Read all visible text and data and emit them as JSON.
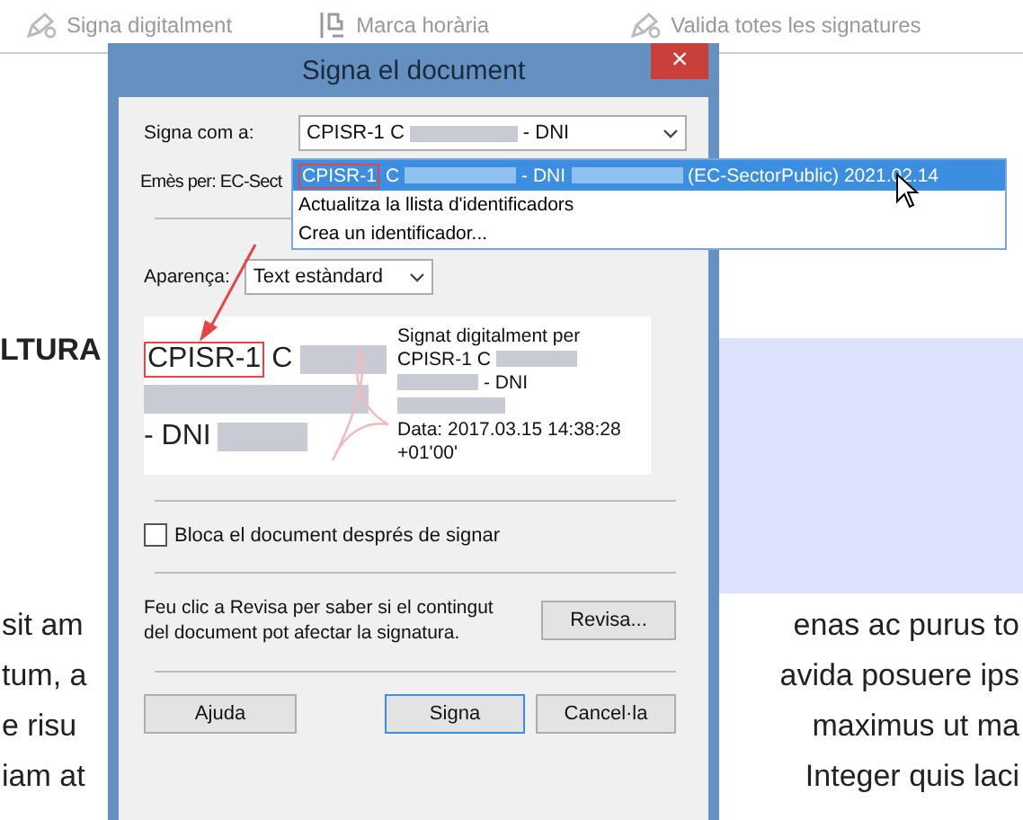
{
  "toolbar": {
    "items": [
      {
        "label": "Signa digitalment"
      },
      {
        "label": "Marca horària"
      },
      {
        "label": "Valida totes les signatures"
      }
    ]
  },
  "page": {
    "heading": "LTURA",
    "lines": [
      {
        "left": "sit am",
        "right": "enas ac purus to"
      },
      {
        "left": "tum, a",
        "right": "avida posuere ips"
      },
      {
        "left": "e risu",
        "right": "maximus ut ma"
      },
      {
        "left": "iam at",
        "right": "Integer quis laci"
      }
    ]
  },
  "dialog": {
    "title": "Signa el document",
    "close": "×",
    "sign_as": {
      "label": "Signa com a:",
      "parts": [
        {
          "kind": "text",
          "text": "CPISR-1 C"
        },
        {
          "kind": "redacted"
        },
        {
          "kind": "text",
          "text": "- DNI"
        }
      ]
    },
    "issuer": {
      "label": "Emès per: EC-Sect"
    },
    "dropdown": [
      {
        "selected": true,
        "parts": [
          {
            "kind": "highlight",
            "text": "CPISR-1"
          },
          {
            "kind": "text",
            "text": "C"
          },
          {
            "kind": "redacted"
          },
          {
            "kind": "text",
            "text": "- DNI"
          },
          {
            "kind": "redacted"
          },
          {
            "kind": "text",
            "text": "(EC-SectorPublic) 2021.02.14"
          }
        ]
      },
      {
        "selected": false,
        "parts": [
          {
            "kind": "text",
            "text": "Actualitza la llista d'identificadors"
          }
        ]
      },
      {
        "selected": false,
        "parts": [
          {
            "kind": "text",
            "text": "Crea un identificador..."
          }
        ]
      }
    ],
    "appearance": {
      "label": "Aparença:",
      "value": "Text estàndard"
    },
    "preview": {
      "left_lines": [
        [
          {
            "kind": "highlight",
            "text": "CPISR-1"
          },
          {
            "kind": "text",
            "text": "C"
          },
          {
            "kind": "redacted"
          }
        ],
        [
          {
            "kind": "redacted"
          }
        ],
        [
          {
            "kind": "text",
            "text": "- DNI"
          },
          {
            "kind": "redacted"
          }
        ]
      ],
      "right_lines": [
        [
          {
            "kind": "text",
            "text": "Signat digitalment per"
          }
        ],
        [
          {
            "kind": "text",
            "text": "CPISR-1 C"
          },
          {
            "kind": "redacted"
          }
        ],
        [
          {
            "kind": "redacted"
          },
          {
            "kind": "text",
            "text": "- DNI"
          }
        ],
        [
          {
            "kind": "redacted"
          }
        ],
        [
          {
            "kind": "text",
            "text": "Data: 2017.03.15 14:38:28"
          }
        ],
        [
          {
            "kind": "text",
            "text": "+01'00'"
          }
        ]
      ]
    },
    "lock": {
      "label": "Bloca el document després de signar",
      "checked": false
    },
    "review": {
      "text": "Feu clic a Revisa per saber si el contingut del document pot afectar la signatura.",
      "button": "Revisa..."
    },
    "buttons": [
      {
        "label": "Ajuda",
        "selected": false
      },
      {
        "label": "Signa",
        "selected": true
      },
      {
        "label": "Cancel·la",
        "selected": false
      }
    ]
  }
}
